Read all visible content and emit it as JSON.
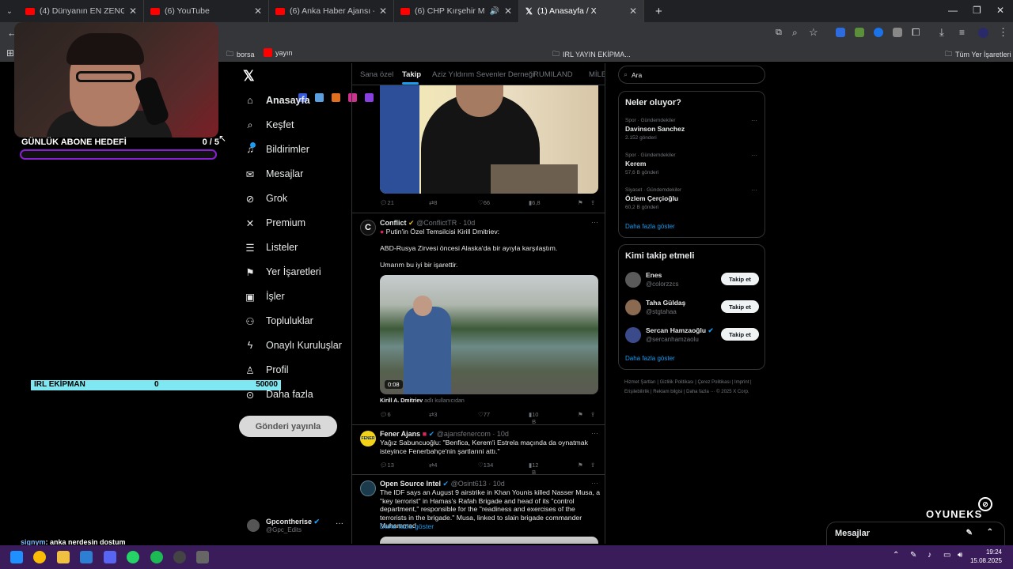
{
  "browser": {
    "tabs": [
      {
        "title": "(4) Dünyanın EN ZENGİN ÜLKES",
        "icon": "youtube-icon"
      },
      {
        "title": "(6) YouTube",
        "icon": "youtube-icon"
      },
      {
        "title": "(6) Anka Haber Ajansı - YouTub",
        "icon": "youtube-icon"
      },
      {
        "title": "(6) CHP Kırşehir Mitingi Car",
        "icon": "youtube-icon"
      },
      {
        "title": "(1) Anasayfa / X",
        "icon": "x-icon"
      }
    ],
    "new_tab": "+",
    "bookmarks": {
      "borsa": "borsa",
      "yayin": "yayın",
      "folder": "IRL YAYIN EKİPMA...",
      "all": "Tüm Yer İşaretleri"
    }
  },
  "overlay": {
    "goal_label": "GÜNLÜK ABONE HEDEFİ",
    "goal_value": "0 / 5",
    "goal_progress": 0,
    "irl_label": "IRL EKİPMAN",
    "irl_value": "0",
    "irl_target": "50000",
    "chat_user": "signym",
    "chat_message": ": anka nerdesin dostum",
    "brand": "OYUNEKS"
  },
  "x": {
    "nav": {
      "home": "Anasayfa",
      "explore": "Keşfet",
      "notifications": "Bildirimler",
      "messages": "Mesajlar",
      "grok": "Grok",
      "premium": "Premium",
      "lists": "Listeler",
      "bookmarks": "Yer İşaretleri",
      "jobs": "İşler",
      "communities": "Topluluklar",
      "verified_orgs": "Onaylı Kuruluşlar",
      "profile": "Profil",
      "more": "Daha fazla"
    },
    "post_button": "Gönderi yayınla",
    "account": {
      "name": "Gpconthe",
      "name_cont": "rise",
      "handle": "@Gpc_Edits"
    },
    "feed_tabs": [
      "Sana özel",
      "Takip",
      "Aziz Yıldırım Sevenler Derneği",
      "RUMILAND",
      "MİLEN"
    ],
    "tweets": [
      {
        "replies": "21",
        "retweets": "8",
        "likes": "66",
        "views": "6,8"
      },
      {
        "name": "Conflict",
        "handle": "@ConflictTR · 10d",
        "line1": "Putin'in Özel Temsilcisi Kirill Dmitriev:",
        "line2": "ABD-Rusya Zirvesi öncesi Alaska'da bir ayıyla karşılaştım.",
        "line3": "Umarım bu iyi bir işarettir.",
        "video_time": "0:08",
        "credit_name": "Kirill A. Dmitriev",
        "credit_suffix": "adlı kullanıcıdan",
        "replies": "6",
        "retweets": "3",
        "likes": "77",
        "views": "10 B"
      },
      {
        "name": "Fener Ajans",
        "handle": "@ajansfenercom · 10d",
        "text": "Yağız Sabuncuoğlu: \"Benfica, Kerem'i Estrela maçında da oynatmak isteyince Fenerbahçe'nin şartlarıni attı.\"",
        "replies": "13",
        "retweets": "4",
        "likes": "134",
        "views": "12 B"
      },
      {
        "name": "Open Source Intel",
        "handle": "@Osint613 · 10d",
        "text": "The IDF says an August 9 airstrike in Khan Younis killed Nasser Musa, a \"key terrorist\" in Hamas's Rafah Brigade and head of its \"control department,\" responsible for the \"readiness and exercises of the terrorists in the brigade.\" Musa, linked to slain brigade commander Muhammad",
        "show_more": "Daha fazla göster"
      }
    ],
    "search_placeholder": "Ara",
    "trends": {
      "title": "Neler oluyor?",
      "items": [
        {
          "category": "Spor · Gündemdekiler",
          "name": "Davinson Sanchez",
          "count": "2.152 gönderi"
        },
        {
          "category": "Spor · Gündemdekiler",
          "name": "Kerem",
          "count": "57,6 B gönderi"
        },
        {
          "category": "Siyaset · Gündemdekiler",
          "name": "Özlem Çerçioğlu",
          "count": "60,2 B gönderi"
        }
      ],
      "show_more": "Daha fazla göster"
    },
    "follow": {
      "title": "Kimi takip etmeli",
      "items": [
        {
          "name": "Enes",
          "handle": "@colorzzcs",
          "button": "Takip et"
        },
        {
          "name": "Taha Güldaş",
          "handle": "@stgtahaa",
          "button": "Takip et"
        },
        {
          "name": "Sercan Hamzaoğlu",
          "handle": "@sercanhamzaolu",
          "button": "Takip et"
        }
      ],
      "show_more": "Daha fazla göster"
    },
    "footer": "Hizmet Şartları | Gizlilik Politikası | Çerez Politikası | Imprint | Erişilebilirlik | Reklam bilgisi | Daha fazla ··· © 2025 X Corp.",
    "messages_panel": "Mesajlar"
  },
  "taskbar": {
    "time": "19:24",
    "date": "15.08.2025"
  },
  "colors": {
    "accent": "#1d9bf0",
    "taskbar": "#3b1c5a",
    "goal_border": "#8a1fd3",
    "irl_bar": "#7fe7f1"
  }
}
